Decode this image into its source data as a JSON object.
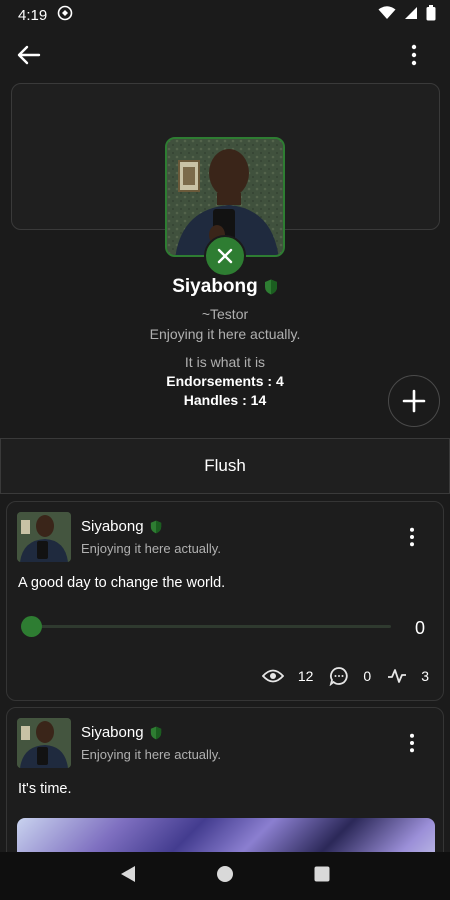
{
  "status_bar": {
    "time": "4:19"
  },
  "profile": {
    "name": "Siyabong",
    "handle": "~Testor",
    "bio": "Enjoying it here actually.",
    "status": "It is what it is",
    "endorsements_text": "Endorsements : 4",
    "handles_text": "Handles : 14"
  },
  "section_tab": {
    "label": "Flush"
  },
  "posts": [
    {
      "author": "Siyabong",
      "author_bio": "Enjoying it here actually.",
      "text": "A good day to change the world.",
      "slider_value": "0",
      "views": "12",
      "comments": "0",
      "reactions": "3"
    },
    {
      "author": "Siyabong",
      "author_bio": "Enjoying it here actually.",
      "text": "It's time."
    }
  ],
  "colors": {
    "accent": "#2e7d32",
    "background": "#1b1b1b",
    "muted_text": "#b0b0b0"
  },
  "icons": {
    "back": "arrow-back-icon",
    "menu": "more-vertical-icon",
    "verified": "shield-icon",
    "unfollow": "close-icon",
    "add": "plus-icon",
    "views": "eye-icon",
    "comments": "chat-bubble-icon",
    "reactions": "activity-icon"
  }
}
